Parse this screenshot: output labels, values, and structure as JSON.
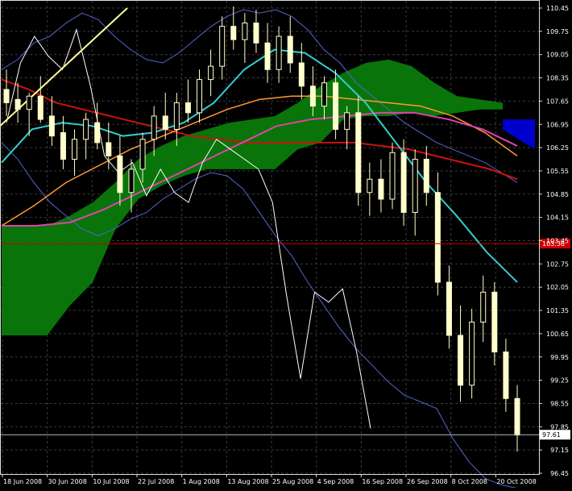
{
  "chart_data": {
    "type": "candlestick",
    "grid": true,
    "y_range": [
      96.45,
      110.45
    ],
    "y_ticks": [
      "110.45",
      "109.75",
      "109.05",
      "108.35",
      "107.65",
      "106.95",
      "106.25",
      "105.55",
      "104.85",
      "104.15",
      "103.45",
      "102.75",
      "102.05",
      "101.35",
      "100.65",
      "99.95",
      "99.25",
      "98.55",
      "97.85",
      "97.15",
      "96.45"
    ],
    "x_ticks": [
      "18 Jun 2008",
      "30 Jun 2008",
      "10 Jul 2008",
      "22 Jul 2008",
      "1 Aug 2008",
      "13 Aug 2008",
      "25 Aug 2008",
      "4 Sep 2008",
      "16 Sep 2008",
      "26 Sep 2008",
      "8 Oct 2008",
      "20 Oct 2008"
    ],
    "markers": {
      "red_line": {
        "label": "103.36",
        "value": 103.36,
        "color": "#cc0000"
      },
      "current_price": {
        "label": "97.61",
        "value": 97.61,
        "color": "#ffffff"
      }
    },
    "colors": {
      "background": "#000000",
      "grid": "#3a3a3a",
      "candle": "#ffffcc",
      "cloud": "#0a7a0a",
      "cloud_bear": "#0000cc",
      "cyan_ma": "#33cccc",
      "orange_ma": "#ff9933",
      "magenta_ma": "#dd44aa",
      "red_ma": "#cc1111",
      "envelope": "#5566cc",
      "chikou": "#ffffff",
      "trendline": "#ffff99"
    },
    "candles": [
      [
        108.0,
        108.6,
        107.2,
        107.6
      ],
      [
        107.7,
        108.2,
        107.0,
        107.4
      ],
      [
        107.4,
        107.9,
        106.6,
        107.8
      ],
      [
        107.8,
        108.4,
        107.0,
        107.1
      ],
      [
        107.2,
        107.8,
        106.3,
        106.6
      ],
      [
        106.7,
        107.2,
        105.6,
        105.9
      ],
      [
        105.9,
        106.8,
        105.4,
        106.5
      ],
      [
        106.5,
        107.3,
        105.9,
        107.1
      ],
      [
        107.0,
        107.6,
        106.2,
        106.4
      ],
      [
        106.4,
        107.0,
        105.6,
        106.0
      ],
      [
        106.0,
        106.6,
        104.5,
        104.9
      ],
      [
        104.9,
        105.9,
        104.3,
        105.6
      ],
      [
        105.6,
        106.7,
        105.2,
        106.5
      ],
      [
        106.5,
        107.5,
        106.0,
        107.2
      ],
      [
        107.2,
        107.9,
        106.5,
        106.8
      ],
      [
        106.8,
        107.9,
        106.3,
        107.6
      ],
      [
        107.6,
        108.3,
        107.0,
        107.3
      ],
      [
        107.3,
        108.6,
        107.0,
        108.3
      ],
      [
        108.3,
        109.2,
        107.8,
        108.7
      ],
      [
        108.7,
        110.2,
        108.3,
        109.9
      ],
      [
        109.9,
        110.5,
        109.2,
        109.5
      ],
      [
        109.5,
        110.3,
        108.8,
        110.0
      ],
      [
        110.0,
        110.4,
        109.1,
        109.4
      ],
      [
        109.4,
        110.0,
        108.2,
        108.6
      ],
      [
        108.6,
        109.9,
        108.2,
        109.6
      ],
      [
        109.6,
        110.2,
        108.5,
        108.8
      ],
      [
        108.8,
        109.4,
        107.7,
        108.1
      ],
      [
        108.1,
        108.7,
        107.2,
        107.5
      ],
      [
        107.5,
        108.4,
        107.1,
        108.2
      ],
      [
        108.2,
        108.6,
        106.5,
        106.8
      ],
      [
        106.8,
        107.5,
        106.2,
        107.3
      ],
      [
        107.3,
        107.8,
        104.5,
        104.9
      ],
      [
        104.9,
        105.8,
        104.2,
        105.3
      ],
      [
        105.3,
        105.9,
        104.3,
        104.7
      ],
      [
        104.7,
        106.4,
        104.4,
        106.1
      ],
      [
        106.1,
        106.5,
        103.9,
        104.3
      ],
      [
        104.3,
        106.2,
        103.6,
        105.9
      ],
      [
        105.9,
        106.3,
        104.5,
        104.9
      ],
      [
        104.9,
        105.5,
        101.8,
        102.2
      ],
      [
        102.2,
        102.7,
        100.2,
        100.6
      ],
      [
        100.6,
        101.5,
        98.6,
        99.1
      ],
      [
        99.1,
        101.4,
        98.7,
        101.0
      ],
      [
        101.0,
        102.4,
        100.4,
        101.9
      ],
      [
        101.9,
        102.2,
        99.7,
        100.1
      ],
      [
        100.1,
        100.5,
        98.3,
        98.7
      ],
      [
        98.7,
        99.1,
        97.1,
        97.6
      ]
    ],
    "envelope_upper": [
      108.6,
      108.9,
      109.4,
      109.6,
      110.0,
      110.3,
      110.1,
      109.6,
      109.2,
      108.9,
      108.8,
      109.1,
      109.5,
      109.9,
      110.2,
      110.4,
      110.3,
      110.4,
      110.2,
      109.8,
      109.2,
      108.8,
      108.2,
      107.8,
      107.4,
      107.0,
      106.7,
      106.4,
      106.2,
      106.0,
      105.8,
      105.5,
      105.2
    ],
    "envelope_lower": [
      106.4,
      105.9,
      105.2,
      104.6,
      104.2,
      103.8,
      103.6,
      103.8,
      104.1,
      104.3,
      104.7,
      105.0,
      105.3,
      105.5,
      105.4,
      105.0,
      104.3,
      103.6,
      103.0,
      102.2,
      101.5,
      100.8,
      100.2,
      99.7,
      99.2,
      98.8,
      98.6,
      98.4,
      97.5,
      96.8,
      96.3,
      96.1,
      96.0
    ]
  }
}
